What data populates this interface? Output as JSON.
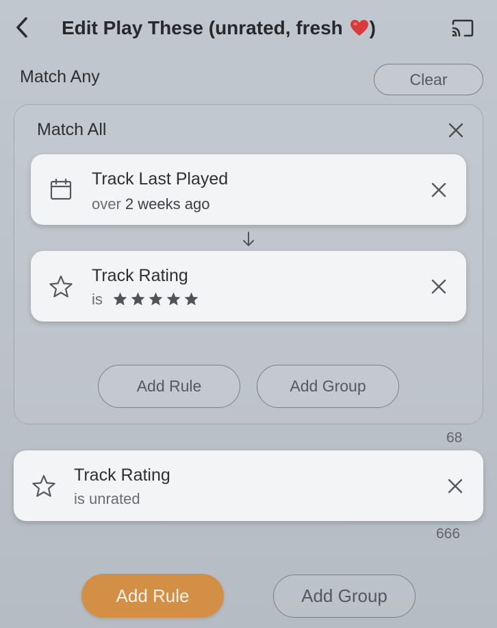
{
  "header": {
    "title_prefix": "Edit Play These (unrated, fresh ",
    "title_suffix": ")",
    "back_icon": "chevron-left-icon",
    "cast_icon": "cast-icon"
  },
  "root": {
    "match_label": "Match Any",
    "clear_label": "Clear"
  },
  "group": {
    "match_label": "Match All",
    "rules": [
      {
        "name": "Track Last Played",
        "operator": "over",
        "value": "2 weeks ago",
        "icon": "calendar-icon"
      },
      {
        "name": "Track Rating",
        "operator": "is",
        "rating_stars": 5,
        "icon": "star-outline-icon"
      }
    ],
    "add_rule_label": "Add Rule",
    "add_group_label": "Add Group",
    "count": "68"
  },
  "rule": {
    "name": "Track Rating",
    "condition": "is unrated",
    "icon": "star-outline-icon",
    "count": "666"
  },
  "footer": {
    "add_rule_label": "Add Rule",
    "add_group_label": "Add Group"
  },
  "colors": {
    "accent": "#d38f45",
    "background": "#bec4cb",
    "card": "#f3f4f6",
    "heart": "#d93b3b"
  }
}
